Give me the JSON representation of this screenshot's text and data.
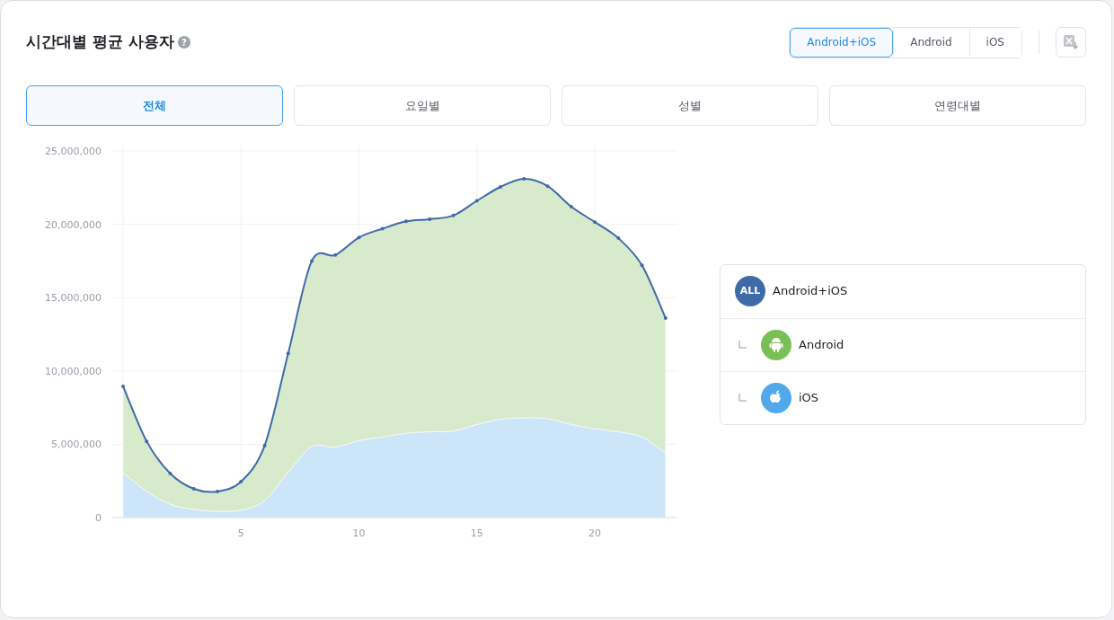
{
  "title": "시간대별 평균 사용자",
  "help": "?",
  "platforms": [
    {
      "label": "Android+iOS",
      "selected": true
    },
    {
      "label": "Android",
      "selected": false
    },
    {
      "label": "iOS",
      "selected": false
    }
  ],
  "tabs": [
    {
      "label": "전체",
      "selected": true
    },
    {
      "label": "요일별",
      "selected": false
    },
    {
      "label": "성별",
      "selected": false
    },
    {
      "label": "연령대별",
      "selected": false
    }
  ],
  "chart_data": {
    "type": "area",
    "stacked": true,
    "grid": true,
    "x": [
      0,
      1,
      2,
      3,
      4,
      5,
      6,
      7,
      8,
      9,
      10,
      11,
      12,
      13,
      14,
      15,
      16,
      17,
      18,
      19,
      20,
      21,
      22,
      23
    ],
    "xlim": [
      0,
      23.5
    ],
    "ylim": [
      0,
      25000000
    ],
    "xticks": [
      5,
      10,
      15,
      20
    ],
    "yticks": [
      {
        "value": 0,
        "label": "0"
      },
      {
        "value": 5000000,
        "label": "5,000,000"
      },
      {
        "value": 10000000,
        "label": "10,000,000"
      },
      {
        "value": 15000000,
        "label": "15,000,000"
      },
      {
        "value": 20000000,
        "label": "20,000,000"
      },
      {
        "value": 25000000,
        "label": "25,000,000"
      }
    ],
    "series": [
      {
        "name": "Android",
        "color": "#d8eacc",
        "values": [
          5890000,
          3400000,
          2100000,
          1410000,
          1350000,
          1950000,
          3750000,
          8100000,
          12650000,
          13100000,
          13850000,
          14200000,
          14450000,
          14500000,
          14700000,
          15250000,
          15850000,
          16300000,
          15850000,
          14850000,
          14100000,
          13200000,
          11700000,
          9200000
        ]
      },
      {
        "name": "iOS",
        "color": "#cce5f8",
        "values": [
          3060000,
          1800000,
          900000,
          550000,
          430000,
          500000,
          1150000,
          3100000,
          4850000,
          4800000,
          5250000,
          5500000,
          5750000,
          5850000,
          5900000,
          6350000,
          6700000,
          6800000,
          6750000,
          6350000,
          6050000,
          5850000,
          5500000,
          4400000
        ]
      }
    ]
  },
  "legend": [
    {
      "kind": "all",
      "badge": "ALL",
      "label": "Android+iOS",
      "color": "#3f6aa8",
      "children": [
        {
          "kind": "android",
          "color": "#7abf55"
        },
        {
          "kind": "ios",
          "color": "#4fa9ea"
        }
      ]
    }
  ]
}
